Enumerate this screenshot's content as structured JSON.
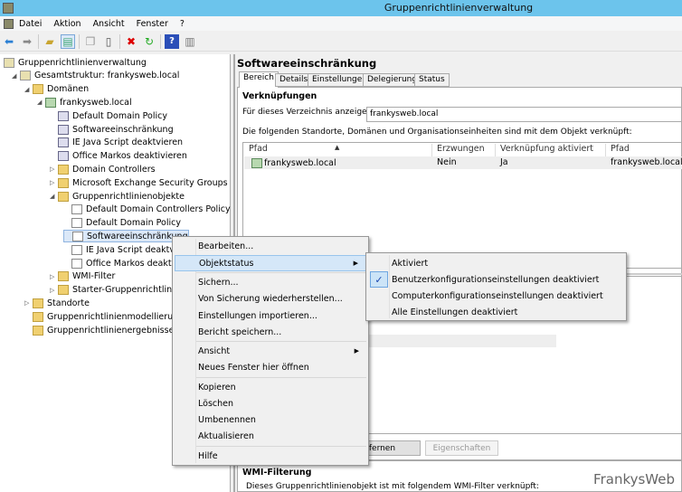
{
  "window": {
    "title": "Gruppenrichtlinienverwaltung"
  },
  "menubar": [
    "Datei",
    "Aktion",
    "Ansicht",
    "Fenster",
    "?"
  ],
  "toolbar": [
    "back-icon",
    "forward-icon",
    "up-folder-icon",
    "show-hide-tree-icon",
    "copy-icon",
    "paste-icon",
    "delete-icon",
    "refresh-icon",
    "help-icon",
    "properties-icon"
  ],
  "tree": [
    {
      "label": "Gruppenrichtlinienverwaltung",
      "level": 0,
      "exp": "",
      "icon": "console"
    },
    {
      "label": "Gesamtstruktur: frankysweb.local",
      "level": 1,
      "exp": "◢",
      "icon": "forest"
    },
    {
      "label": "Domänen",
      "level": 2,
      "exp": "◢",
      "icon": "folder"
    },
    {
      "label": "frankysweb.local",
      "level": 3,
      "exp": "◢",
      "icon": "dom"
    },
    {
      "label": "Default Domain Policy",
      "level": 4,
      "exp": "",
      "icon": "link"
    },
    {
      "label": "Softwareeinschränkung",
      "level": 4,
      "exp": "",
      "icon": "link"
    },
    {
      "label": "IE Java Script deaktvieren",
      "level": 4,
      "exp": "",
      "icon": "link"
    },
    {
      "label": "Office Markos deaktivieren",
      "level": 4,
      "exp": "",
      "icon": "link"
    },
    {
      "label": "Domain Controllers",
      "level": 4,
      "exp": "▷",
      "icon": "folder"
    },
    {
      "label": "Microsoft Exchange Security Groups",
      "level": 4,
      "exp": "▷",
      "icon": "folder"
    },
    {
      "label": "Gruppenrichtlinienobjekte",
      "level": 4,
      "exp": "◢",
      "icon": "folder"
    },
    {
      "label": "Default Domain Controllers Policy",
      "level": 5,
      "exp": "",
      "icon": "gpo"
    },
    {
      "label": "Default Domain Policy",
      "level": 5,
      "exp": "",
      "icon": "gpo"
    },
    {
      "label": "Softwareeinschränkung",
      "level": 5,
      "exp": "",
      "icon": "gpo",
      "selected": true
    },
    {
      "label": "IE Java Script deaktvieren",
      "level": 5,
      "exp": "",
      "icon": "gpo"
    },
    {
      "label": "Office Markos deaktivieren",
      "level": 5,
      "exp": "",
      "icon": "gpo"
    },
    {
      "label": "WMI-Filter",
      "level": 4,
      "exp": "▷",
      "icon": "folder"
    },
    {
      "label": "Starter-Gruppenrichtlinienobjekte",
      "level": 4,
      "exp": "▷",
      "icon": "folder"
    },
    {
      "label": "Standorte",
      "level": 2,
      "exp": "▷",
      "icon": "folder"
    },
    {
      "label": "Gruppenrichtlinienmodellierung",
      "level": 2,
      "exp": "",
      "icon": "folder"
    },
    {
      "label": "Gruppenrichtlinienergebnisse",
      "level": 2,
      "exp": "",
      "icon": "folder"
    }
  ],
  "details": {
    "title": "Softwareeinschränkung",
    "tabs": [
      "Bereich",
      "Details",
      "Einstellungen",
      "Delegierung",
      "Status"
    ],
    "active_tab": "Bereich",
    "links_heading": "Verknüpfungen",
    "show_label": "Für dieses Verzeichnis anzeigen:",
    "show_value": "frankysweb.local",
    "links_desc": "Die folgenden Standorte, Domänen und Organisationseinheiten sind mit dem Objekt verknüpft:",
    "columns": [
      "Pfad",
      "Erzwungen",
      "Verknüpfung aktiviert",
      "Pfad"
    ],
    "rows": [
      [
        "frankysweb.local",
        "Nein",
        "Ja",
        "frankysweb.local"
      ]
    ],
    "remove_button": "Entfernen",
    "properties_button": "Eigenschaften",
    "wmi_heading": "WMI-Filterung",
    "wmi_desc": "Dieses Gruppenrichtlinienobjekt ist mit folgendem WMI-Filter verknüpft:"
  },
  "context_menu": {
    "items": [
      "Bearbeiten...",
      "Objektstatus",
      "Sichern...",
      "Von Sicherung wiederherstellen...",
      "Einstellungen importieren...",
      "Bericht speichern...",
      "Ansicht",
      "Neues Fenster hier öffnen",
      "Kopieren",
      "Löschen",
      "Umbenennen",
      "Aktualisieren",
      "Hilfe"
    ],
    "highlighted": "Objektstatus"
  },
  "submenu": {
    "items": [
      "Aktiviert",
      "Benutzerkonfigurationseinstellungen deaktiviert",
      "Computerkonfigurationseinstellungen deaktiviert",
      "Alle Einstellungen deaktiviert"
    ],
    "checked": "Benutzerkonfigurationseinstellungen deaktiviert"
  },
  "watermark": "FrankysWeb"
}
